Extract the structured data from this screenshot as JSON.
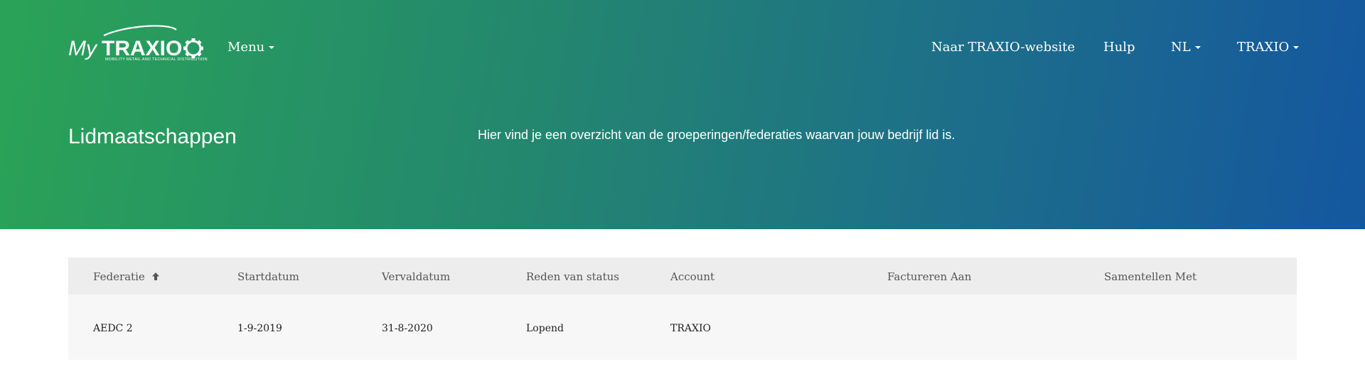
{
  "header": {
    "logo_text_my": "My",
    "logo_text_brand": "TRAXIO",
    "logo_subtitle": "MOBILITY RETAIL AND TECHNICAL DISTRIBUTION",
    "menu_label": "Menu",
    "nav": {
      "website_label": "Naar TRAXIO-website",
      "help_label": "Hulp",
      "language_label": "NL",
      "account_label": "TRAXIO"
    }
  },
  "page": {
    "title": "Lidmaatschappen",
    "description": "Hier vind je een overzicht van de groeperingen/federaties waarvan jouw bedrijf lid is."
  },
  "table": {
    "columns": [
      "Federatie",
      "Startdatum",
      "Vervaldatum",
      "Reden van status",
      "Account",
      "Factureren Aan",
      "Samentellen Met"
    ],
    "sorted_column": "Federatie",
    "sort_direction": "ascending",
    "rows": [
      {
        "federatie": "AEDC 2",
        "startdatum": "1-9-2019",
        "vervaldatum": "31-8-2020",
        "reden_van_status": "Lopend",
        "account": "TRAXIO",
        "factureren_aan": "",
        "samentellen_met": ""
      }
    ]
  },
  "colors": {
    "gradient_start": "#2aa357",
    "gradient_end": "#14579f",
    "header_row_bg": "#ededed",
    "body_row_bg": "#f7f7f7"
  }
}
